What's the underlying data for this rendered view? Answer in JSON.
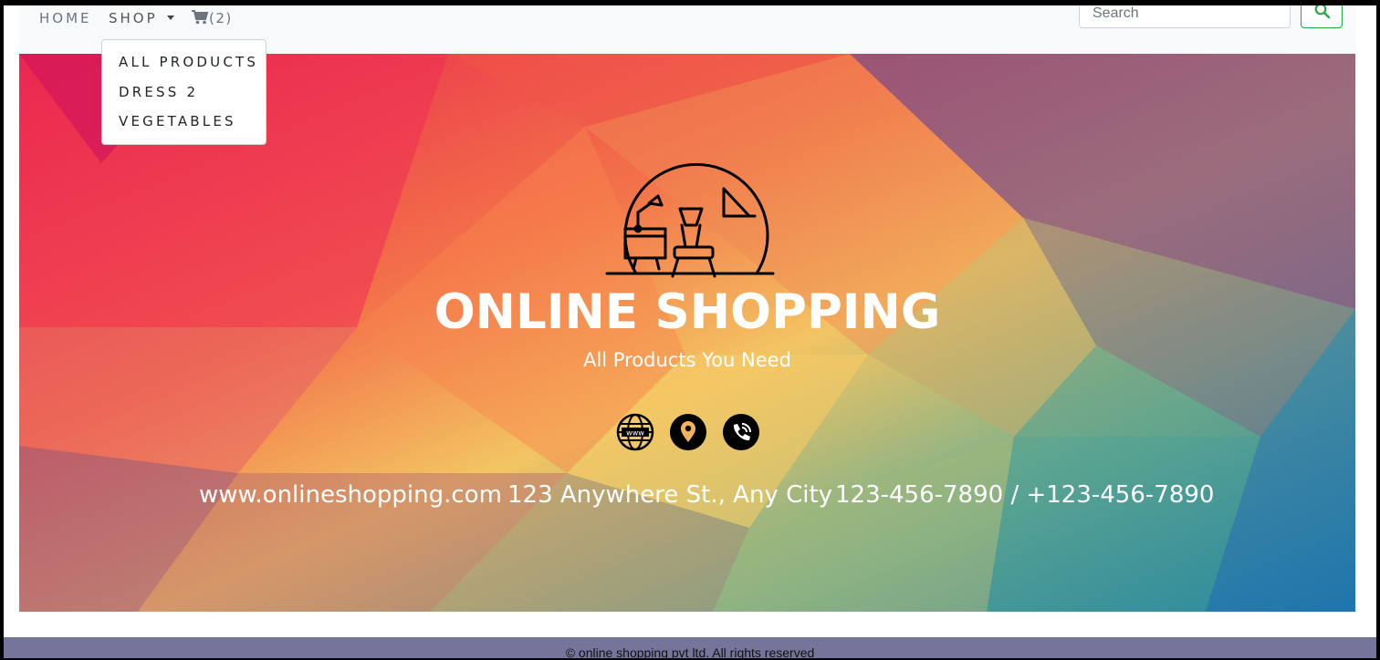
{
  "nav": {
    "home_label": "HOME",
    "shop_label": "SHOP",
    "cart_count": "(2)",
    "search_placeholder": "Search",
    "search_icon": "search-icon",
    "cart_icon": "shopping-cart-icon"
  },
  "dropdown": {
    "items": [
      {
        "label": "ALL PRODUCTS"
      },
      {
        "label": "DRESS 2"
      },
      {
        "label": "VEGETABLES"
      }
    ]
  },
  "hero": {
    "title": "ONLINE SHOPPING",
    "subtitle": "All Products You Need",
    "icons": [
      "globe-www-icon",
      "location-pin-icon",
      "phone-icon"
    ],
    "website": "www.onlineshopping.com",
    "address": "123 Anywhere St., Any City",
    "phone": "123-456-7890 / +123-456-7890"
  },
  "footer": {
    "text": "© online shopping pvt ltd. All rights reserved"
  },
  "colors": {
    "search_button_border": "#28a745",
    "footer_background": "#75759b",
    "navbar_background": "#f8f9fa"
  }
}
